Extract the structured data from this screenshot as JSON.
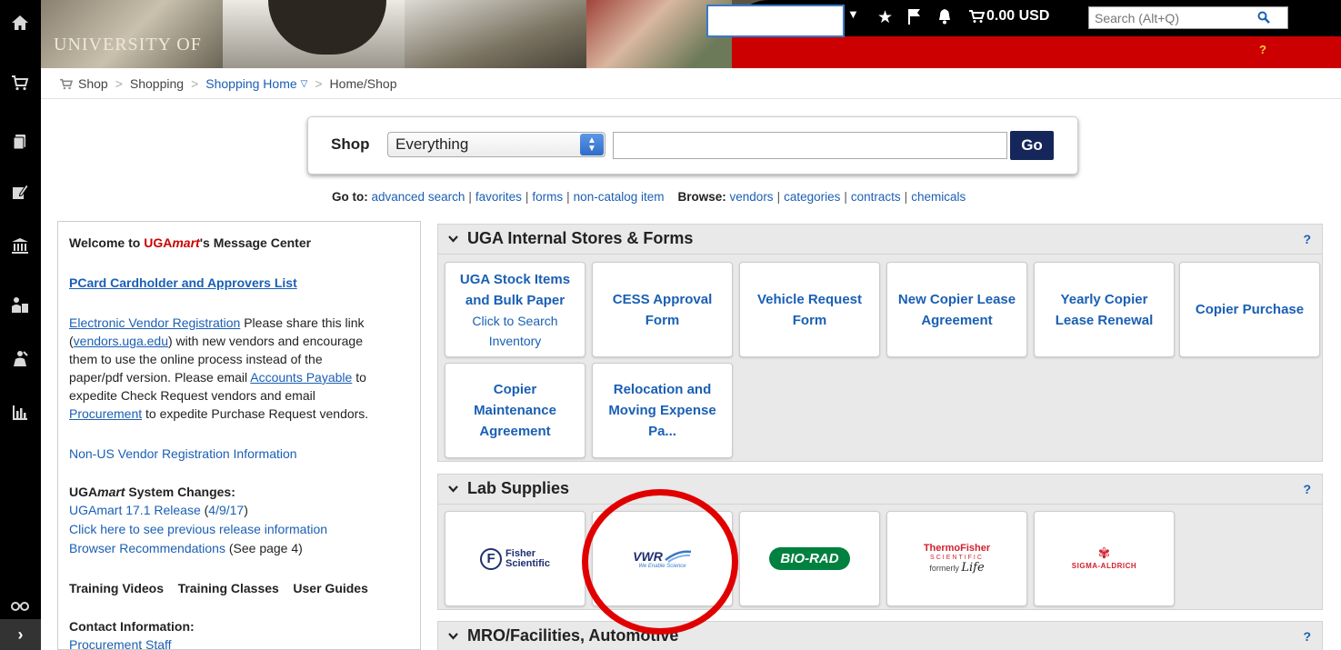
{
  "header": {
    "cart_total": "0.00 USD",
    "search_placeholder": "Search (Alt+Q)",
    "help": "?"
  },
  "banner": {
    "university_text": "UNIVERSITY OF"
  },
  "breadcrumb": {
    "items": [
      "Shop",
      "Shopping",
      "Shopping Home",
      "Home/Shop"
    ]
  },
  "shop_search": {
    "label": "Shop",
    "scope": "Everything",
    "go": "Go"
  },
  "goto": {
    "goto_label": "Go to:",
    "goto_links": [
      "advanced search",
      "favorites",
      "forms",
      "non-catalog item"
    ],
    "browse_label": "Browse:",
    "browse_links": [
      "vendors",
      "categories",
      "contracts",
      "chemicals"
    ]
  },
  "message_center": {
    "title_prefix": "Welcome to ",
    "title_brand_uga": "UGA",
    "title_brand_mart": "mart",
    "title_suffix": "'s Message Center",
    "pcard_link": "PCard Cardholder and Approvers List",
    "evr_link": "Electronic Vendor Registration",
    "evr_text_1": " Please share this link",
    "evr_paren_open": "(",
    "evr_url": "vendors.uga.edu",
    "evr_text_2": ") with new vendors and encourage",
    "evr_text_3": "them to use the online process instead of the",
    "evr_text_4": "paper/pdf version. Please email ",
    "accounts_payable": "Accounts Payable",
    "evr_text_5": " to",
    "evr_text_6": "expedite Check Request vendors and email",
    "procurement": "Procurement",
    "evr_text_7": " to expedite Purchase Request vendors.",
    "non_us": "Non-US Vendor Registration Information",
    "sys_changes_1": "UGA",
    "sys_changes_2": "mart",
    "sys_changes_3": " System Changes:",
    "release_link": "UGAmart 17.1 Release",
    "release_date_open": " (",
    "release_date": "4/9/17",
    "release_date_close": ")",
    "prev_release": "Click here to see previous release information",
    "browser_rec": "Browser Recommendations",
    "browser_rec_note": " (See page 4)",
    "training_videos": "Training Videos",
    "training_classes": "Training Classes",
    "user_guides": "User Guides",
    "contact_title": "Contact Information:",
    "procurement_staff": "Procurement Staff"
  },
  "panels": {
    "internal": {
      "title": "UGA Internal Stores & Forms",
      "help": "?",
      "tiles": [
        {
          "bold": "UGA Stock Items and Bulk Paper",
          "sub": "Click to Search Inventory"
        },
        {
          "bold": "CESS Approval Form",
          "sub": ""
        },
        {
          "bold": "Vehicle Request Form",
          "sub": ""
        },
        {
          "bold": "New Copier Lease Agreement",
          "sub": ""
        },
        {
          "bold": "Yearly Copier Lease Renewal",
          "sub": ""
        },
        {
          "bold": "Copier Purchase",
          "sub": ""
        },
        {
          "bold": "Copier Maintenance Agreement",
          "sub": ""
        },
        {
          "bold": "Relocation and Moving Expense Pa...",
          "sub": ""
        }
      ]
    },
    "lab": {
      "title": "Lab Supplies",
      "help": "?",
      "suppliers": {
        "fisher_f": "F",
        "fisher_name_1": "Fisher",
        "fisher_name_2": "Scientific",
        "vwr": "VWR",
        "vwr_tagline": "We Enable Science",
        "biorad": "BIO-RAD",
        "thermo_1": "ThermoFisher",
        "thermo_2": "SCIENTIFIC",
        "thermo_3": "formerly ",
        "thermo_4": "Life",
        "sigma": "SIGMA-ALDRICH"
      }
    },
    "mro": {
      "title": "MRO/Facilities, Automotive",
      "help": "?"
    }
  },
  "colors": {
    "accent_red": "#cc0000",
    "link_blue": "#1a5fb4",
    "go_navy": "#15275a",
    "annotation_red": "#e00000"
  }
}
